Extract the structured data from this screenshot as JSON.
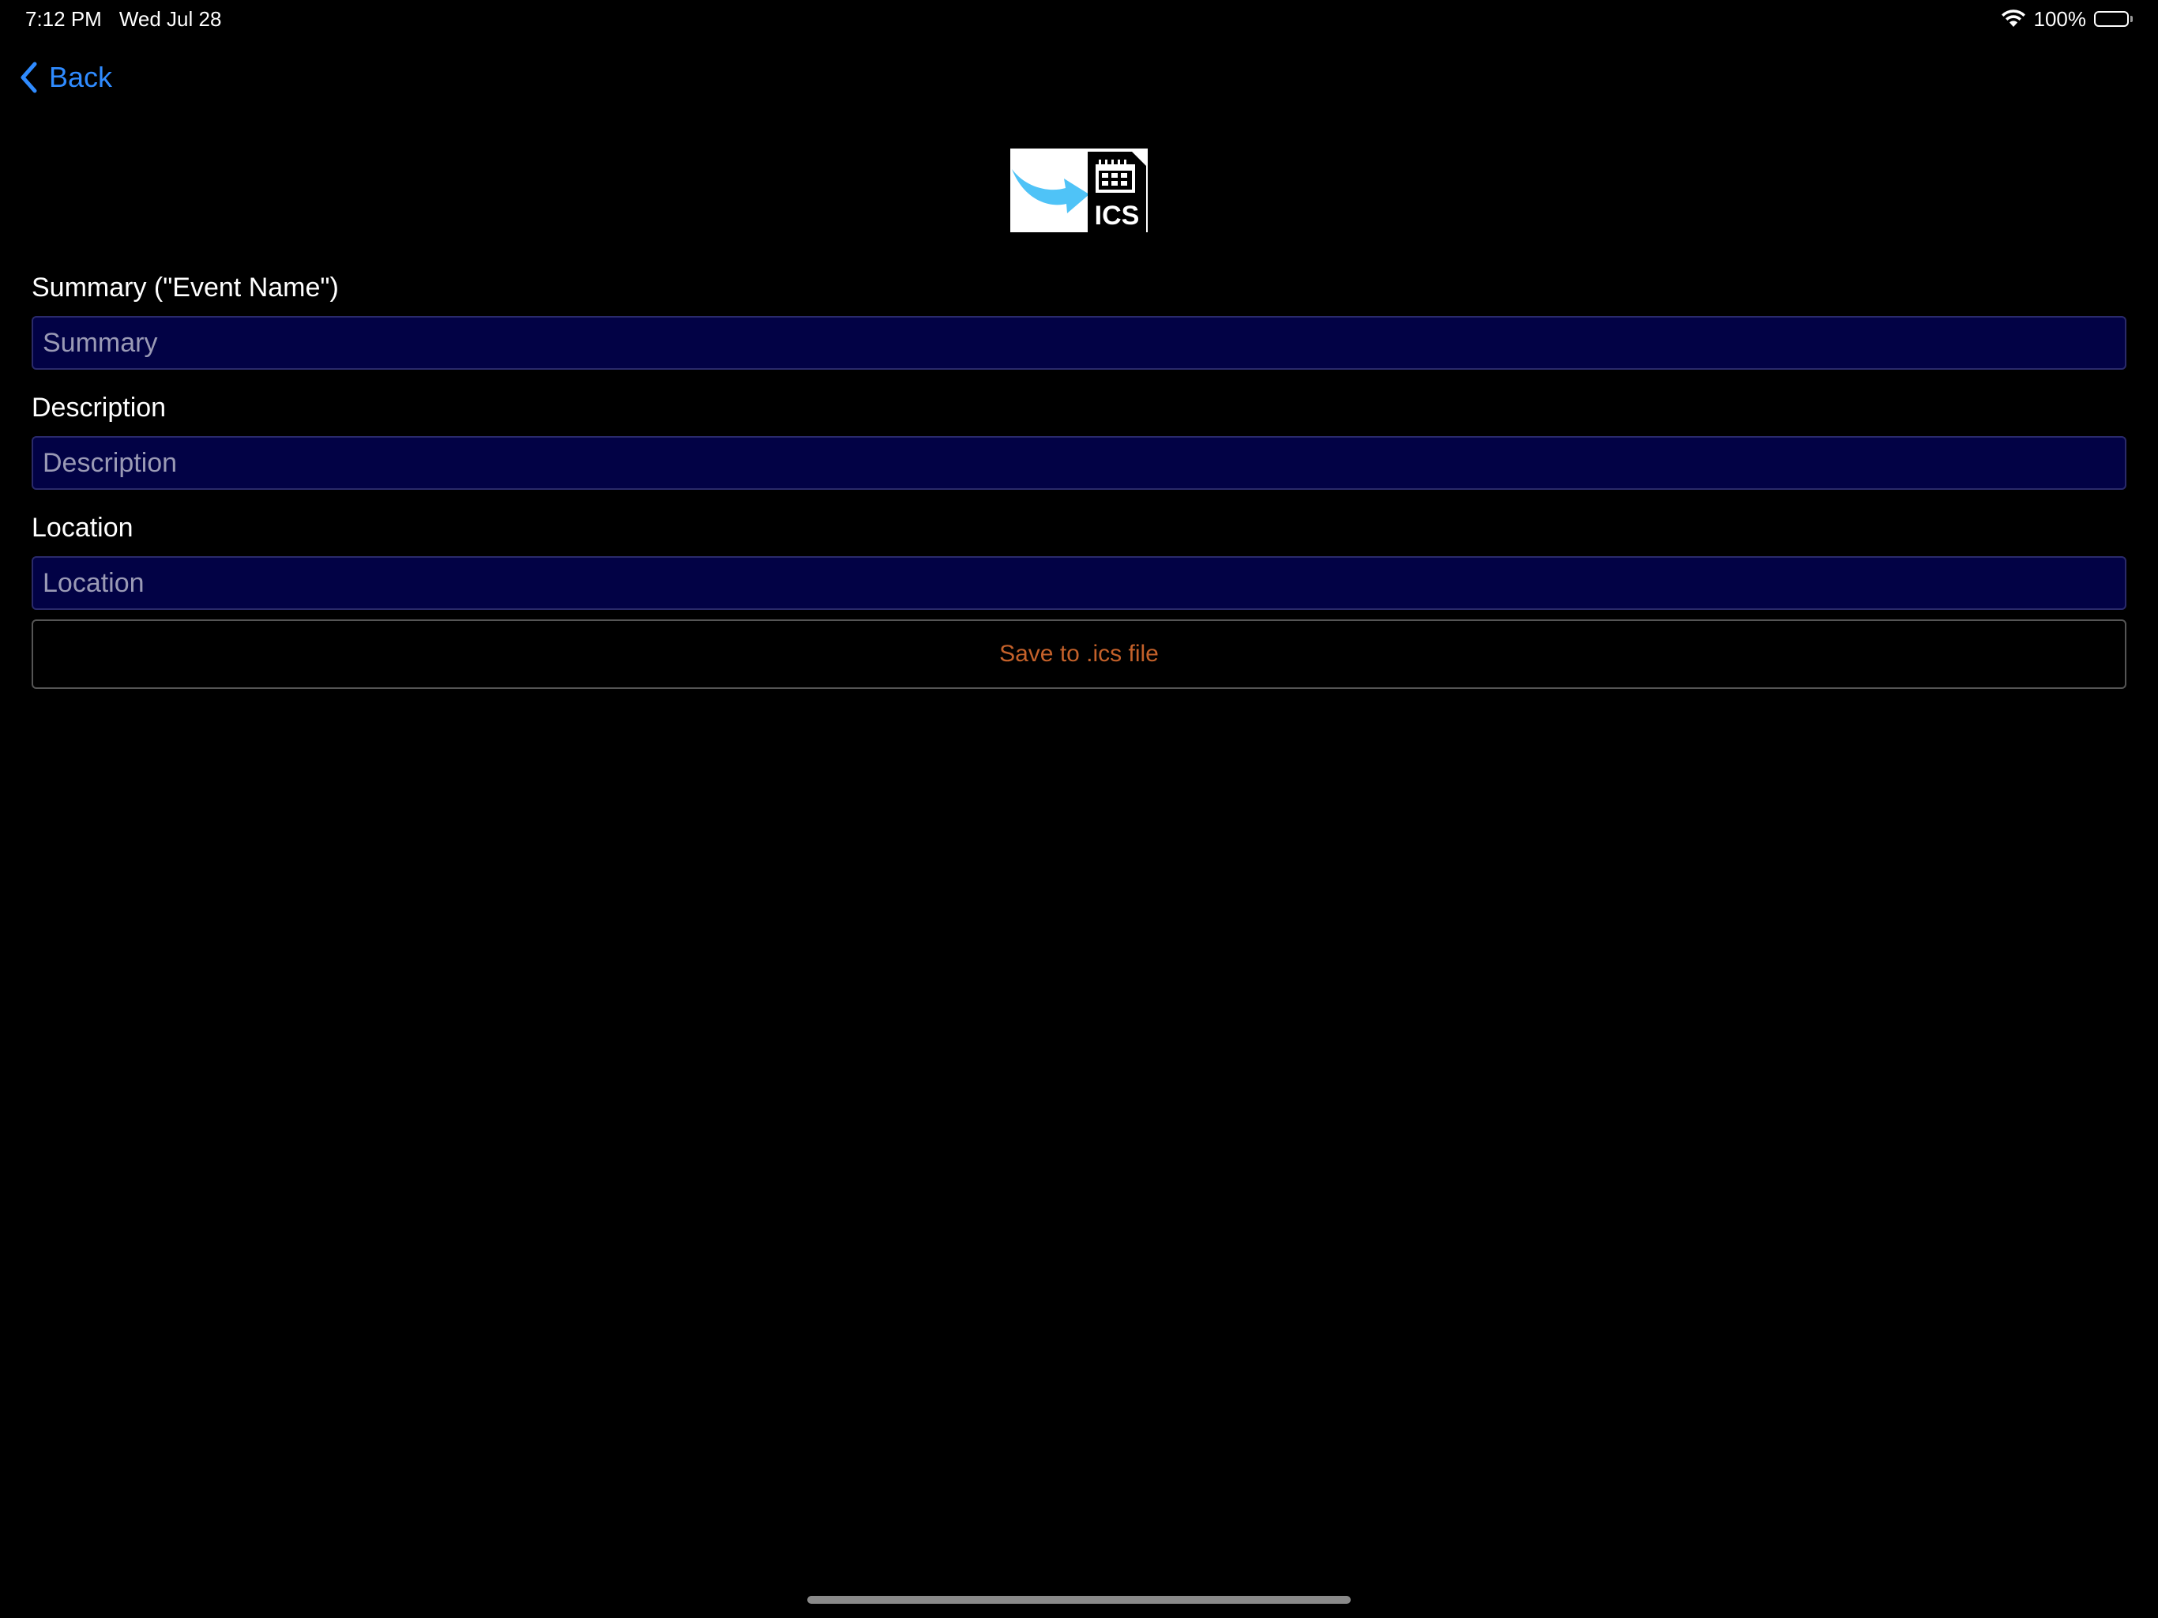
{
  "status_bar": {
    "time": "7:12 PM",
    "date": "Wed Jul 28",
    "battery": "100%",
    "battery_level": 1.0
  },
  "nav": {
    "back_label": "Back",
    "back_icon": "chevron-left-icon"
  },
  "logo": {
    "icon": "export-to-ics-icon",
    "text": "ICS"
  },
  "form": {
    "summary_label": "Summary (\"Event Name\")",
    "summary_placeholder": "Summary",
    "summary_value": "",
    "description_label": "Description",
    "description_placeholder": "Description",
    "description_value": "",
    "location_label": "Location",
    "location_placeholder": "Location",
    "location_value": "",
    "save_label": "Save to .ics file"
  },
  "colors": {
    "background": "#000000",
    "accent_blue": "#2f8bff",
    "input_bg": "#020245",
    "save_text": "#c4612a",
    "arrow_blue": "#4fc3f7"
  }
}
